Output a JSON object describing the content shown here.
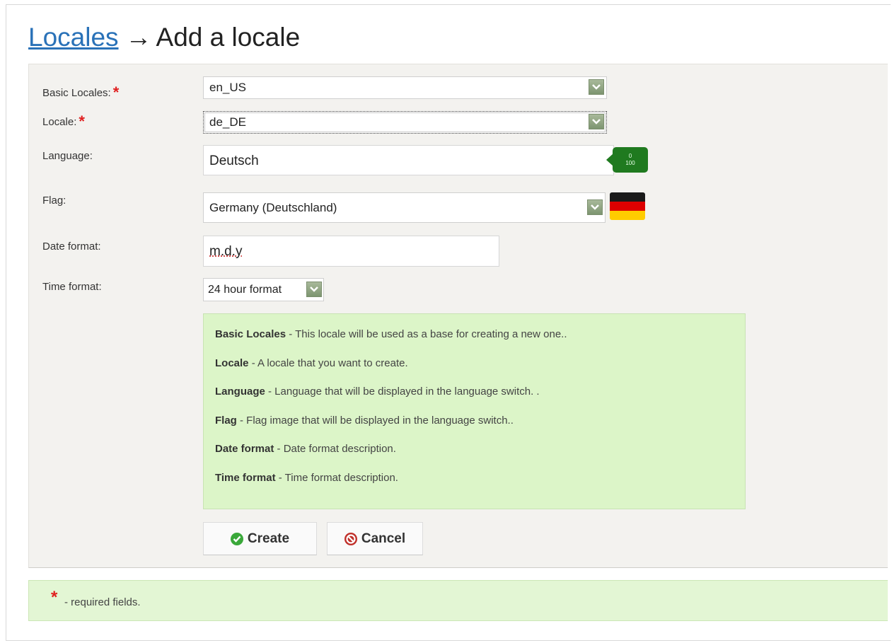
{
  "header": {
    "breadcrumb_link": "Locales",
    "arrow": "→",
    "title": "Add a locale"
  },
  "form": {
    "required_mark": "*",
    "basic_locales": {
      "label": "Basic Locales:",
      "value": "en_US"
    },
    "locale": {
      "label": "Locale:",
      "value": "de_DE"
    },
    "language": {
      "label": "Language:",
      "value": "Deutsch",
      "counter_top": "0",
      "counter_bottom": "100"
    },
    "flag": {
      "label": "Flag:",
      "value": "Germany (Deutschland)",
      "flag_colors": [
        "#1a1a1a",
        "#dd0000",
        "#ffcc00"
      ]
    },
    "date_format": {
      "label": "Date format:",
      "value": "m.d.y"
    },
    "time_format": {
      "label": "Time format:",
      "value": "24 hour format"
    }
  },
  "help": [
    {
      "term": "Basic Locales",
      "desc": " - This locale will be used as a base for creating a new one.."
    },
    {
      "term": "Locale",
      "desc": " - A locale that you want to create."
    },
    {
      "term": "Language",
      "desc": " - Language that will be displayed in the language switch. ."
    },
    {
      "term": "Flag",
      "desc": " - Flag image that will be displayed in the language switch.."
    },
    {
      "term": "Date format",
      "desc": " - Date format description."
    },
    {
      "term": "Time format",
      "desc": " - Time format description."
    }
  ],
  "buttons": {
    "create": {
      "label": "Create",
      "icon": "check-icon",
      "color": "#3aa83a"
    },
    "cancel": {
      "label": "Cancel",
      "icon": "no-entry-icon",
      "color": "#c0302a"
    }
  },
  "footer": {
    "mark": "*",
    "text": "- required fields."
  }
}
